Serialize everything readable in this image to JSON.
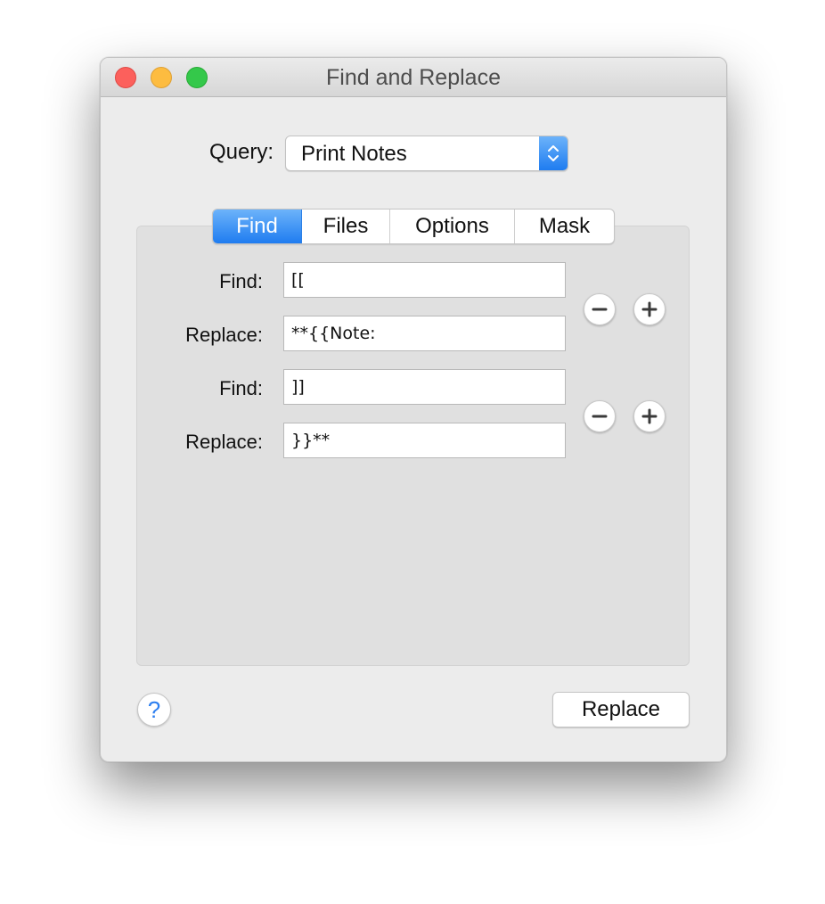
{
  "window": {
    "title": "Find and Replace"
  },
  "query": {
    "label": "Query:",
    "selected": "Print Notes"
  },
  "tabs": [
    {
      "label": "Find",
      "active": true
    },
    {
      "label": "Files",
      "active": false
    },
    {
      "label": "Options",
      "active": false
    },
    {
      "label": "Mask",
      "active": false
    }
  ],
  "rules": [
    {
      "find_label": "Find:",
      "find_value": "[[",
      "replace_label": "Replace:",
      "replace_value": "**{{Note:"
    },
    {
      "find_label": "Find:",
      "find_value": "]]",
      "replace_label": "Replace:",
      "replace_value": "}}**"
    }
  ],
  "footer": {
    "help_label": "?",
    "replace_label": "Replace"
  },
  "colors": {
    "accent": "#2d7ff0",
    "close": "#fc605c",
    "minimize": "#fdbc40",
    "zoom": "#34c84a"
  },
  "icons": {
    "remove": "minus-circle-icon",
    "add": "plus-circle-icon",
    "stepper": "up-down-chevron-icon"
  }
}
